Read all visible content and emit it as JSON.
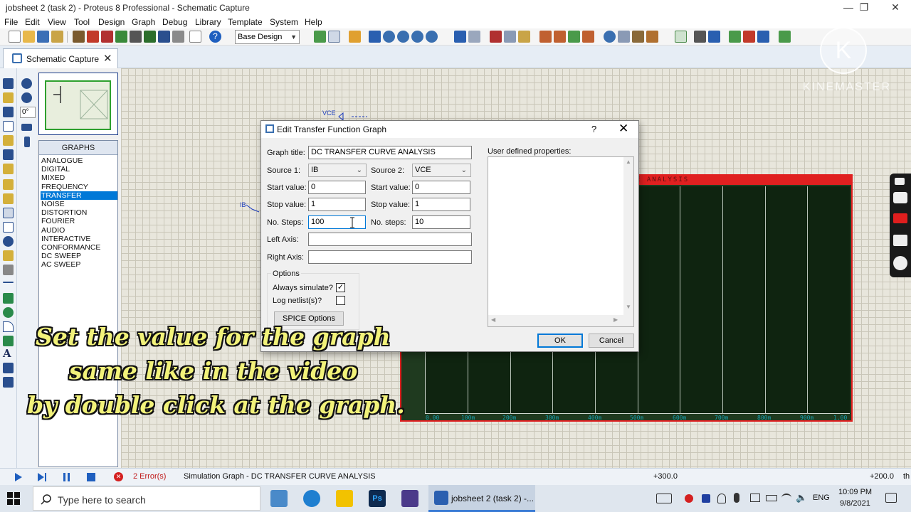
{
  "window": {
    "title": "jobsheet 2 (task 2) - Proteus 8 Professional - Schematic Capture",
    "controls": [
      "—",
      "❐",
      "✕"
    ]
  },
  "menu": [
    "File",
    "Edit",
    "View",
    "Tool",
    "Design",
    "Graph",
    "Debug",
    "Library",
    "Template",
    "System",
    "Help"
  ],
  "toolbar": {
    "design_select": "Base Design"
  },
  "tab": {
    "label": "Schematic Capture",
    "close": "✕"
  },
  "rotation": "0°",
  "graphs_panel": {
    "header": "GRAPHS",
    "items": [
      "ANALOGUE",
      "DIGITAL",
      "MIXED",
      "FREQUENCY",
      "TRANSFER",
      "NOISE",
      "DISTORTION",
      "FOURIER",
      "AUDIO",
      "INTERACTIVE",
      "CONFORMANCE",
      "DC SWEEP",
      "AC SWEEP"
    ],
    "selected": "TRANSFER"
  },
  "canvas": {
    "label_vce": "VCE",
    "label_ib": "IB",
    "graph_title_partial": "E ANALYSIS",
    "x_ticks": [
      "0.00",
      "100m",
      "200m",
      "300m",
      "400m",
      "500m",
      "600m",
      "700m",
      "800m",
      "900m",
      "1.00"
    ]
  },
  "dialog": {
    "title": "Edit Transfer Function Graph",
    "help": "?",
    "close": "✕",
    "graph_title_label": "Graph title:",
    "graph_title_value": "DC TRANSFER CURVE ANALYSIS",
    "source1_label": "Source 1:",
    "source1_value": "IB",
    "source2_label": "Source 2:",
    "source2_value": "VCE",
    "start_label": "Start value:",
    "start1": "0",
    "start2": "0",
    "stop_label": "Stop value:",
    "stop1": "1",
    "stop2": "1",
    "steps1_label": "No. Steps:",
    "steps1": "100",
    "steps2_label": "No. steps:",
    "steps2": "10",
    "left_axis_label": "Left Axis:",
    "right_axis_label": "Right Axis:",
    "user_props_label": "User defined properties:",
    "options_label": "Options",
    "always_sim_label": "Always simulate?",
    "always_sim_checked": "✓",
    "log_netlist_label": "Log netlist(s)?",
    "spice_button": "SPICE Options",
    "ok": "OK",
    "cancel": "Cancel"
  },
  "caption": {
    "line1": "Set the value for the graph",
    "line2": "same like in the video",
    "line3": "by double click at the graph."
  },
  "watermark": {
    "letter": "K",
    "text": "KINEMASTER"
  },
  "status": {
    "errors": "2 Error(s)",
    "message": "Simulation Graph - DC TRANSFER CURVE ANALYSIS",
    "coord_x": "+300.0",
    "coord_y": "+200.0",
    "units": "th"
  },
  "taskbar": {
    "search_placeholder": "Type here to search",
    "active_app": "jobsheet 2 (task 2) -...",
    "lang": "ENG",
    "time": "10:09 PM",
    "date": "9/8/2021"
  },
  "colors": {
    "accent": "#0078d7",
    "graph_border": "#e02020",
    "graph_bg": "#0f2410",
    "caption": "#f2f27a"
  }
}
